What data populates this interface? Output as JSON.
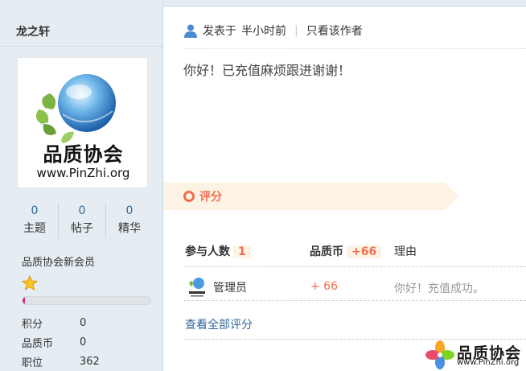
{
  "sidebar": {
    "username": "龙之轩",
    "avatar": {
      "title": "品质协会",
      "url": "www.PinZhi.org"
    },
    "stats": [
      {
        "value": "0",
        "label": "主题"
      },
      {
        "value": "0",
        "label": "帖子"
      },
      {
        "value": "0",
        "label": "精华"
      }
    ],
    "group": "品质协会新会员",
    "level_progress": 0.02,
    "info": [
      {
        "key": "积分",
        "value": "0"
      },
      {
        "key": "品质币",
        "value": "0"
      },
      {
        "key": "职位",
        "value": "362"
      }
    ]
  },
  "post": {
    "posted_prefix": "发表于",
    "posted_time": "半小时前",
    "only_author": "只看该作者",
    "content": "你好！已充值麻烦跟进谢谢！"
  },
  "rating": {
    "section_label": "评分",
    "participants_label": "参与人数",
    "participants_count": "1",
    "coin_label": "品质币",
    "coin_total": "+66",
    "reason_label": "理由",
    "rows": [
      {
        "user": "管理员",
        "amount": "+ 66",
        "reason": "你好！充值成功。"
      }
    ],
    "view_all": "查看全部评分"
  },
  "watermark": {
    "title": "品质协会",
    "url": "www.PinZhi.org"
  },
  "colors": {
    "accent": "#f26c4f",
    "link": "#336699",
    "sidebar_bg": "#e5edf2"
  },
  "icons": [
    "user-icon",
    "star-icon",
    "circle-icon"
  ]
}
